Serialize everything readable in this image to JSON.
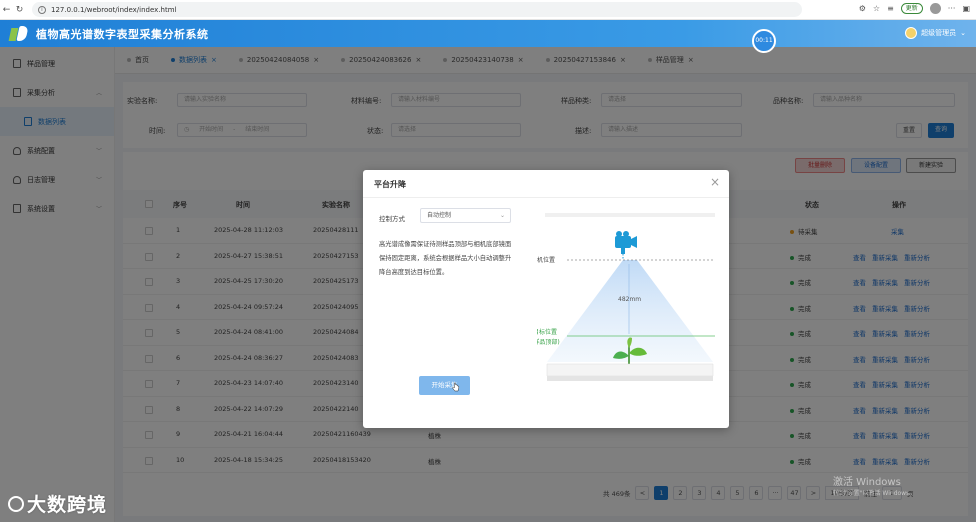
{
  "browser": {
    "url": "127.0.0.1/webroot/index/index.html",
    "update_label": "更新"
  },
  "app": {
    "title": "植物高光谱数字表型采集分析系统",
    "timer": "00:11",
    "user": "超级管理员"
  },
  "sidebar": {
    "items": [
      {
        "label": "样品管理"
      },
      {
        "label": "采集分析"
      },
      {
        "label": "数据列表"
      },
      {
        "label": "系统配置"
      },
      {
        "label": "日志管理"
      },
      {
        "label": "系统设置"
      }
    ]
  },
  "tabs": [
    "首页",
    "数据列表",
    "20250424084058",
    "20250424083626",
    "20250423140738",
    "20250427153846",
    "样品管理"
  ],
  "filter": {
    "exp_name_label": "实验名称:",
    "exp_name_ph": "请输入实验名称",
    "material_label": "材料编号:",
    "material_ph": "请输入材料编号",
    "sample_type_label": "样品种类:",
    "sample_type_ph": "请选择",
    "variety_label": "品种名称:",
    "variety_ph": "请输入品种名称",
    "time_label": "时间:",
    "start_ph": "开始时间",
    "time_sep": "-",
    "end_ph": "结束时间",
    "status_label": "状态:",
    "status_ph": "请选择",
    "desc_label": "描述:",
    "desc_ph": "请输入描述",
    "reset": "重置",
    "search": "查询"
  },
  "toolbar": {
    "delete": "批量删除",
    "settings": "设备配置",
    "new": "新建实验"
  },
  "table": {
    "headers": [
      "序号",
      "时间",
      "实验名称",
      "状态",
      "操作"
    ],
    "rows": [
      {
        "no": "1",
        "time": "2025-04-28 11:12:03",
        "name": "20250428111",
        "material": "",
        "status": "待采集",
        "ops": [
          "采集"
        ]
      },
      {
        "no": "2",
        "time": "2025-04-27 15:38:51",
        "name": "20250427153",
        "material": "",
        "status": "完成",
        "ops": [
          "查看",
          "重新采集",
          "重新分析"
        ]
      },
      {
        "no": "3",
        "time": "2025-04-25 17:30:20",
        "name": "20250425173",
        "material": "",
        "status": "完成",
        "ops": [
          "查看",
          "重新采集",
          "重新分析"
        ]
      },
      {
        "no": "4",
        "time": "2025-04-24 09:57:24",
        "name": "20250424095",
        "material": "",
        "status": "完成",
        "ops": [
          "查看",
          "重新采集",
          "重新分析"
        ]
      },
      {
        "no": "5",
        "time": "2025-04-24 08:41:00",
        "name": "20250424084",
        "material": "",
        "status": "完成",
        "ops": [
          "查看",
          "重新采集",
          "重新分析"
        ]
      },
      {
        "no": "6",
        "time": "2025-04-24 08:36:27",
        "name": "20250424083",
        "material": "",
        "status": "完成",
        "ops": [
          "查看",
          "重新采集",
          "重新分析"
        ]
      },
      {
        "no": "7",
        "time": "2025-04-23 14:07:40",
        "name": "20250423140",
        "material": "",
        "status": "完成",
        "ops": [
          "查看",
          "重新采集",
          "重新分析"
        ]
      },
      {
        "no": "8",
        "time": "2025-04-22 14:07:29",
        "name": "20250422140",
        "material": "",
        "status": "完成",
        "ops": [
          "查看",
          "重新采集",
          "重新分析"
        ]
      },
      {
        "no": "9",
        "time": "2025-04-21 16:04:44",
        "name": "20250421160439",
        "material": "植株",
        "status": "完成",
        "ops": [
          "查看",
          "重新采集",
          "重新分析"
        ]
      },
      {
        "no": "10",
        "time": "2025-04-18 15:34:25",
        "name": "20250418153420",
        "material": "植株",
        "status": "完成",
        "ops": [
          "查看",
          "重新采集",
          "重新分析"
        ]
      }
    ]
  },
  "pager": {
    "total": "共 469条",
    "pages": [
      "1",
      "2",
      "3",
      "4",
      "5",
      "6",
      "···",
      "47"
    ],
    "prev": "<",
    "next": ">",
    "per": "10条/页",
    "goto": "前往",
    "goto_val": "1",
    "page_suffix": "页"
  },
  "modal": {
    "title": "平台升降",
    "control_label": "控制方式",
    "control_value": "自动控制",
    "desc": "高光谱成像需保证待测样品顶部与相机底部镜面保持固定距离，系统会根据样品大小自动调整升降台高度到达目标位置。",
    "start": "开始采集",
    "camera_pos": "相机位置",
    "distance": "482mm",
    "target_pos": "目标位置",
    "target_sub": "(样品顶部)"
  },
  "watermark": {
    "win1": "激活 Windows",
    "win2": "转到\"设置\"以激活 Windows。",
    "brand": "大数跨境"
  }
}
